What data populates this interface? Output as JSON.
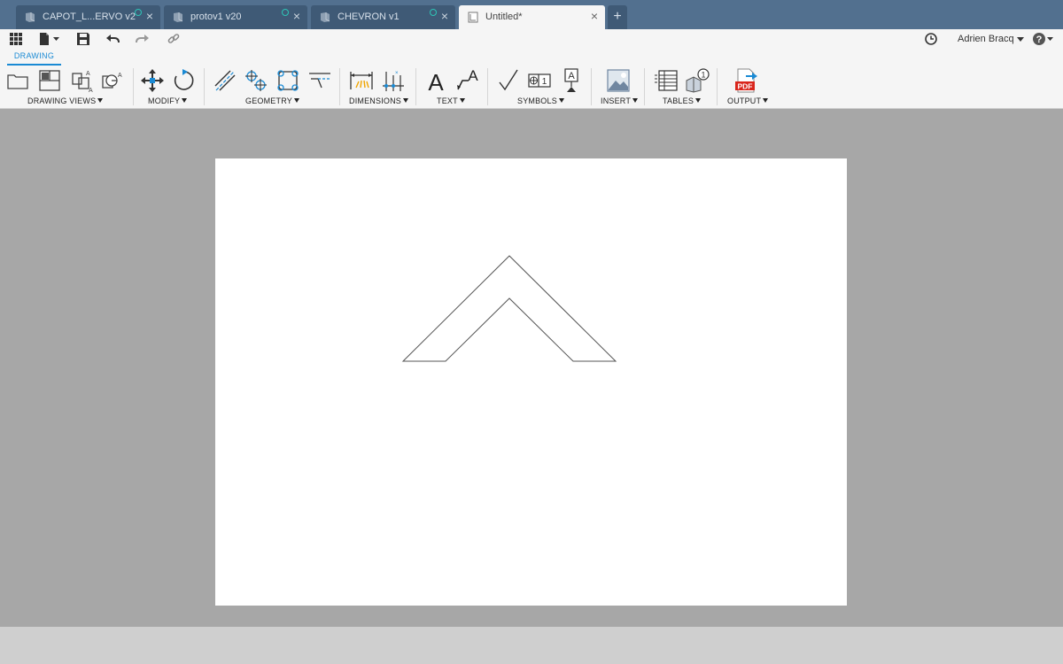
{
  "tabs": [
    {
      "label": "CAPOT_L...ERVO v2",
      "active": false,
      "synced": true
    },
    {
      "label": "protov1 v20",
      "active": false,
      "synced": true
    },
    {
      "label": "CHEVRON v1",
      "active": false,
      "synced": true
    },
    {
      "label": "Untitled*",
      "active": true,
      "synced": false
    }
  ],
  "new_tab_label": "+",
  "user": {
    "name": "Adrien Bracq"
  },
  "workspace_tab": "DRAWING",
  "ribbon_groups": [
    {
      "label": "DRAWING VIEWS"
    },
    {
      "label": "MODIFY"
    },
    {
      "label": "GEOMETRY"
    },
    {
      "label": "DIMENSIONS"
    },
    {
      "label": "TEXT"
    },
    {
      "label": "SYMBOLS"
    },
    {
      "label": "INSERT"
    },
    {
      "label": "TABLES"
    },
    {
      "label": "OUTPUT"
    }
  ],
  "icons": {
    "text_glyph": "A",
    "pdf_label": "PDF",
    "balloon_number": "1"
  },
  "colors": {
    "tabbar": "#52708f",
    "accent": "#1a8ad4",
    "toolbar": "#f5f5f5",
    "canvas": "#a7a7a7",
    "sheet": "#ffffff"
  }
}
